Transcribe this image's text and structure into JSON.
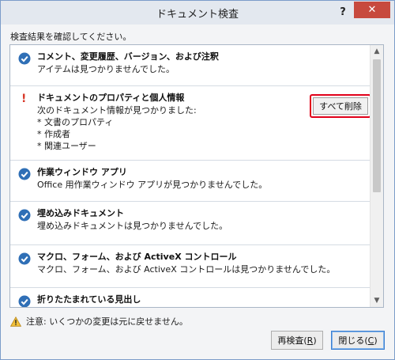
{
  "window": {
    "title": "ドキュメント検査",
    "help_label": "?",
    "close_label": "✕"
  },
  "subtitle": "検査結果を確認してください。",
  "results": [
    {
      "status": "ok",
      "title": "コメント、変更履歴、バージョン、および注釈",
      "description": [
        "アイテムは見つかりませんでした。"
      ]
    },
    {
      "status": "found",
      "status_mark": "!",
      "title": "ドキュメントのプロパティと個人情報",
      "description": [
        "次のドキュメント情報が見つかりました:",
        "* 文書のプロパティ",
        "* 作成者",
        "* 関連ユーザー"
      ],
      "action_label": "すべて削除"
    },
    {
      "status": "ok",
      "title": "作業ウィンドウ アプリ",
      "description": [
        "Office 用作業ウィンドウ アプリが見つかりませんでした。"
      ]
    },
    {
      "status": "ok",
      "title": "埋め込みドキュメント",
      "description": [
        "埋め込みドキュメントは見つかりませんでした。"
      ]
    },
    {
      "status": "ok",
      "title": "マクロ、フォーム、および ActiveX コントロール",
      "description": [
        "マクロ、フォーム、および ActiveX コントロールは見つかりませんでした。"
      ]
    },
    {
      "status": "ok",
      "title": "折りたたまれている見出し",
      "description": []
    }
  ],
  "footer": {
    "warning_text": "注意: いくつかの変更は元に戻せません。",
    "reinspect_label": "再検査(",
    "reinspect_key": "R",
    "reinspect_suffix": ")",
    "close_label": "閉じる(",
    "close_key": "C",
    "close_suffix": ")"
  },
  "colors": {
    "check_blue": "#2f6fb6",
    "warning_red": "#d83a2a",
    "highlight_red": "#e1001a"
  }
}
